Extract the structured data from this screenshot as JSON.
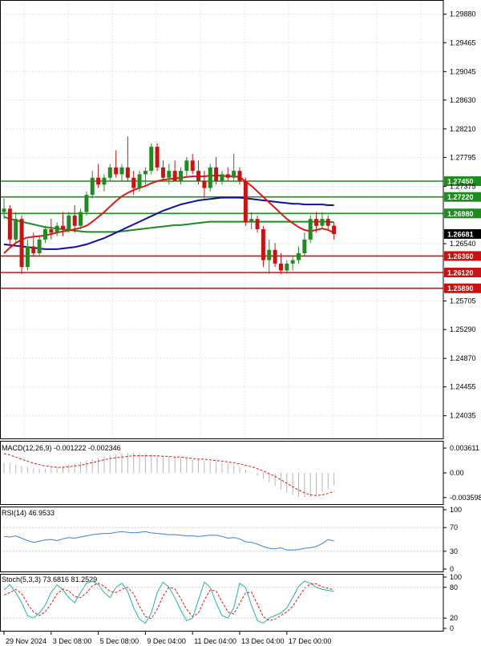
{
  "chart_data": {
    "type": "candlestick",
    "price_panel": {
      "ylim": [
        1.2374,
        1.3004
      ],
      "y_ticks": [
        "1.29880",
        "1.29465",
        "1.29045",
        "1.28630",
        "1.28210",
        "1.27795",
        "1.27375",
        "1.26540",
        "1.25705",
        "1.25290",
        "1.24870",
        "1.24455",
        "1.24035"
      ],
      "h_levels": [
        {
          "value": 1.2745,
          "label": "1.27450",
          "color": "#1e8c1e"
        },
        {
          "value": 1.2722,
          "label": "1.27220",
          "color": "#1e8c1e"
        },
        {
          "value": 1.2698,
          "label": "1.26980",
          "color": "#1e8c1e"
        },
        {
          "value": 1.2636,
          "label": "1.26360",
          "color": "#cc1111"
        },
        {
          "value": 1.2612,
          "label": "1.26120",
          "color": "#cc1111"
        },
        {
          "value": 1.2589,
          "label": "1.25890",
          "color": "#cc1111"
        }
      ],
      "current_price": {
        "value": 1.26681,
        "label": "1.26681"
      },
      "candles": [
        [
          1.27,
          1.272,
          1.269,
          1.2705
        ],
        [
          1.2705,
          1.271,
          1.265,
          1.266
        ],
        [
          1.266,
          1.27,
          1.2655,
          1.269
        ],
        [
          1.269,
          1.2695,
          1.261,
          1.262
        ],
        [
          1.262,
          1.266,
          1.2615,
          1.265
        ],
        [
          1.265,
          1.267,
          1.2635,
          1.264
        ],
        [
          1.264,
          1.2665,
          1.2635,
          1.266
        ],
        [
          1.266,
          1.268,
          1.2655,
          1.2675
        ],
        [
          1.2675,
          1.269,
          1.266,
          1.267
        ],
        [
          1.267,
          1.2685,
          1.2665,
          1.268
        ],
        [
          1.268,
          1.27,
          1.2665,
          1.2675
        ],
        [
          1.2675,
          1.27,
          1.267,
          1.2695
        ],
        [
          1.2695,
          1.271,
          1.267,
          1.268
        ],
        [
          1.268,
          1.2705,
          1.2675,
          1.27
        ],
        [
          1.27,
          1.273,
          1.2695,
          1.2725
        ],
        [
          1.2725,
          1.276,
          1.272,
          1.275
        ],
        [
          1.275,
          1.277,
          1.2735,
          1.274
        ],
        [
          1.274,
          1.2755,
          1.273,
          1.275
        ],
        [
          1.275,
          1.277,
          1.2745,
          1.2765
        ],
        [
          1.2765,
          1.279,
          1.275,
          1.2755
        ],
        [
          1.2755,
          1.277,
          1.2745,
          1.2765
        ],
        [
          1.2765,
          1.281,
          1.2745,
          1.275
        ],
        [
          1.275,
          1.276,
          1.2725,
          1.2735
        ],
        [
          1.2735,
          1.276,
          1.273,
          1.2755
        ],
        [
          1.2755,
          1.2765,
          1.274,
          1.276
        ],
        [
          1.276,
          1.28,
          1.2755,
          1.2795
        ],
        [
          1.2795,
          1.28,
          1.276,
          1.2765
        ],
        [
          1.2765,
          1.2775,
          1.2745,
          1.275
        ],
        [
          1.275,
          1.277,
          1.274,
          1.276
        ],
        [
          1.276,
          1.2775,
          1.2745,
          1.2745
        ],
        [
          1.2745,
          1.2765,
          1.274,
          1.276
        ],
        [
          1.276,
          1.278,
          1.275,
          1.2775
        ],
        [
          1.2775,
          1.2785,
          1.2755,
          1.276
        ],
        [
          1.276,
          1.2775,
          1.274,
          1.2745
        ],
        [
          1.2745,
          1.276,
          1.272,
          1.2735
        ],
        [
          1.2735,
          1.277,
          1.273,
          1.2765
        ],
        [
          1.2765,
          1.278,
          1.274,
          1.2745
        ],
        [
          1.2745,
          1.276,
          1.274,
          1.2755
        ],
        [
          1.2755,
          1.2765,
          1.2745,
          1.275
        ],
        [
          1.275,
          1.2785,
          1.2745,
          1.276
        ],
        [
          1.276,
          1.2765,
          1.274,
          1.2745
        ],
        [
          1.2745,
          1.275,
          1.268,
          1.2685
        ],
        [
          1.2685,
          1.27,
          1.2675,
          1.269
        ],
        [
          1.269,
          1.2695,
          1.267,
          1.2675
        ],
        [
          1.2675,
          1.268,
          1.262,
          1.263
        ],
        [
          1.263,
          1.266,
          1.261,
          1.2645
        ],
        [
          1.2645,
          1.2655,
          1.262,
          1.2625
        ],
        [
          1.2625,
          1.264,
          1.261,
          1.2615
        ],
        [
          1.2615,
          1.263,
          1.261,
          1.2625
        ],
        [
          1.2625,
          1.2635,
          1.2615,
          1.263
        ],
        [
          1.263,
          1.265,
          1.2625,
          1.264
        ],
        [
          1.264,
          1.267,
          1.2635,
          1.266
        ],
        [
          1.266,
          1.2695,
          1.2655,
          1.269
        ],
        [
          1.269,
          1.27,
          1.267,
          1.268
        ],
        [
          1.268,
          1.27,
          1.2675,
          1.269
        ],
        [
          1.269,
          1.2695,
          1.2675,
          1.268
        ],
        [
          1.268,
          1.2685,
          1.266,
          1.2668
        ]
      ],
      "ma_fast": [
        1.264,
        1.2648,
        1.2655,
        1.266,
        1.2663,
        1.2664,
        1.2665,
        1.2666,
        1.2668,
        1.267,
        1.2672,
        1.2673,
        1.2675,
        1.2677,
        1.268,
        1.2686,
        1.2693,
        1.27,
        1.2708,
        1.2716,
        1.2723,
        1.2728,
        1.2732,
        1.2735,
        1.2738,
        1.2742,
        1.2745,
        1.2747,
        1.2748,
        1.2749,
        1.275,
        1.2751,
        1.2752,
        1.2752,
        1.2752,
        1.2753,
        1.2753,
        1.2753,
        1.2752,
        1.2752,
        1.2751,
        1.2745,
        1.2738,
        1.273,
        1.2722,
        1.2714,
        1.2706,
        1.2698,
        1.269,
        1.2684,
        1.2678,
        1.2674,
        1.2672,
        1.2674,
        1.2676,
        1.2674,
        1.267
      ],
      "ma_mid": [
        1.2653,
        1.2652,
        1.2651,
        1.265,
        1.2649,
        1.2648,
        1.2647,
        1.2646,
        1.2646,
        1.2646,
        1.2647,
        1.2648,
        1.2649,
        1.2651,
        1.2653,
        1.2656,
        1.2659,
        1.2662,
        1.2666,
        1.267,
        1.2674,
        1.2678,
        1.2682,
        1.2686,
        1.269,
        1.2694,
        1.2698,
        1.2702,
        1.2705,
        1.2708,
        1.2711,
        1.2713,
        1.2715,
        1.2717,
        1.2718,
        1.2719,
        1.272,
        1.2721,
        1.2721,
        1.2721,
        1.2721,
        1.272,
        1.2719,
        1.2718,
        1.2717,
        1.2716,
        1.2715,
        1.2714,
        1.2713,
        1.2712,
        1.2712,
        1.2711,
        1.2711,
        1.2711,
        1.2711,
        1.271,
        1.271
      ],
      "ma_slow": [
        1.2693,
        1.269,
        1.2688,
        1.2686,
        1.2684,
        1.2682,
        1.268,
        1.2678,
        1.2677,
        1.2676,
        1.2675,
        1.2674,
        1.2673,
        1.2672,
        1.2671,
        1.2671,
        1.2671,
        1.2671,
        1.2671,
        1.2671,
        1.2672,
        1.2673,
        1.2674,
        1.2675,
        1.2676,
        1.2677,
        1.2678,
        1.2679,
        1.268,
        1.2681,
        1.2681,
        1.2682,
        1.2683,
        1.2684,
        1.2685,
        1.2686,
        1.2686,
        1.2686,
        1.2686,
        1.2686,
        1.2686,
        1.2686,
        1.2686,
        1.2686,
        1.2686,
        1.2686,
        1.2686,
        1.2686,
        1.2686,
        1.2686,
        1.2686,
        1.2686,
        1.2686,
        1.2686,
        1.2686,
        1.2686,
        1.2685
      ]
    },
    "macd_panel": {
      "title": "MACD(12,26,9) -0.001222 -0.002346",
      "ylim": [
        -0.0042,
        0.0042
      ],
      "y_ticks": [
        {
          "value": 0.003611,
          "label": "0.003611"
        },
        {
          "value": 0.0,
          "label": "0.00"
        },
        {
          "value": -0.003598,
          "label": "-0.003598"
        }
      ],
      "histogram": [
        0.0015,
        0.0014,
        0.0012,
        0.001,
        0.0008,
        0.0007,
        0.0006,
        0.0006,
        0.0007,
        0.0008,
        0.001,
        0.0012,
        0.0014,
        0.0016,
        0.0018,
        0.002,
        0.0022,
        0.0024,
        0.0026,
        0.0027,
        0.0028,
        0.0029,
        0.0029,
        0.0029,
        0.0028,
        0.0027,
        0.0026,
        0.0025,
        0.0024,
        0.0023,
        0.0022,
        0.0021,
        0.002,
        0.0019,
        0.0018,
        0.0017,
        0.0016,
        0.0015,
        0.0013,
        0.0011,
        0.0009,
        0.0005,
        0.0001,
        -0.0004,
        -0.0009,
        -0.0014,
        -0.0019,
        -0.0024,
        -0.0029,
        -0.0032,
        -0.0035,
        -0.0036,
        -0.0035,
        -0.0032,
        -0.0028,
        -0.0024,
        -0.0018
      ],
      "signal": [
        0.0028,
        0.0026,
        0.0023,
        0.002,
        0.0017,
        0.0014,
        0.0012,
        0.001,
        0.0009,
        0.0008,
        0.0008,
        0.0009,
        0.001,
        0.0011,
        0.0013,
        0.0015,
        0.0017,
        0.0019,
        0.0021,
        0.0022,
        0.0023,
        0.0024,
        0.0025,
        0.0025,
        0.0025,
        0.0025,
        0.0025,
        0.0024,
        0.0024,
        0.0023,
        0.0023,
        0.0022,
        0.0021,
        0.002,
        0.002,
        0.0019,
        0.0018,
        0.0017,
        0.0016,
        0.0015,
        0.0013,
        0.0011,
        0.0009,
        0.0006,
        0.0003,
        -0.0001,
        -0.0005,
        -0.001,
        -0.0015,
        -0.002,
        -0.0025,
        -0.0029,
        -0.0032,
        -0.0033,
        -0.0032,
        -0.003,
        -0.0027
      ]
    },
    "rsi_panel": {
      "title": "RSI(14) 46.9533",
      "ylim": [
        0,
        100
      ],
      "y_ticks": [
        {
          "value": 100,
          "label": "100"
        },
        {
          "value": 70,
          "label": "70"
        },
        {
          "value": 30,
          "label": "30"
        },
        {
          "value": 0,
          "label": "0"
        }
      ],
      "values": [
        55,
        54,
        56,
        52,
        48,
        45,
        47,
        49,
        50,
        48,
        51,
        53,
        52,
        54,
        56,
        58,
        59,
        60,
        60,
        62,
        63,
        62,
        61,
        62,
        63,
        61,
        60,
        59,
        58,
        58,
        57,
        56,
        56,
        55,
        56,
        57,
        57,
        55,
        52,
        53,
        51,
        46,
        45,
        42,
        38,
        35,
        34,
        36,
        32,
        32,
        33,
        35,
        36,
        38,
        43,
        50,
        47
      ]
    },
    "stoch_panel": {
      "title": "Stoch(5,3,3) 73.6816 81.2529",
      "ylim": [
        0,
        100
      ],
      "y_ticks": [
        {
          "value": 100,
          "label": "100"
        },
        {
          "value": 80,
          "label": "80"
        },
        {
          "value": 20,
          "label": "20"
        },
        {
          "value": 0,
          "label": "0"
        }
      ],
      "k": [
        75,
        85,
        70,
        50,
        25,
        20,
        30,
        45,
        70,
        85,
        75,
        60,
        50,
        70,
        88,
        92,
        85,
        70,
        60,
        80,
        88,
        72,
        40,
        18,
        10,
        30,
        70,
        90,
        80,
        60,
        35,
        15,
        20,
        55,
        90,
        80,
        50,
        25,
        20,
        40,
        88,
        80,
        45,
        15,
        10,
        20,
        25,
        30,
        40,
        60,
        82,
        92,
        88,
        80,
        76,
        74,
        72
      ],
      "d": [
        65,
        70,
        76,
        68,
        48,
        32,
        25,
        32,
        48,
        67,
        77,
        73,
        62,
        60,
        69,
        83,
        88,
        82,
        72,
        70,
        76,
        80,
        67,
        43,
        23,
        19,
        37,
        63,
        80,
        77,
        58,
        37,
        23,
        30,
        55,
        75,
        73,
        52,
        32,
        28,
        49,
        69,
        71,
        47,
        23,
        15,
        18,
        25,
        32,
        43,
        61,
        78,
        87,
        87,
        81,
        78,
        75
      ]
    },
    "time_axis": {
      "labels": [
        {
          "index": 0,
          "label": "29 Nov 2024"
        },
        {
          "index": 8,
          "label": "3 Dec 08:00"
        },
        {
          "index": 16,
          "label": "5 Dec 08:00"
        },
        {
          "index": 24,
          "label": "9 Dec 04:00"
        },
        {
          "index": 32,
          "label": "11 Dec 04:00"
        },
        {
          "index": 40,
          "label": "13 Dec 04:00"
        },
        {
          "index": 48,
          "label": "17 Dec 00:00"
        }
      ]
    }
  }
}
